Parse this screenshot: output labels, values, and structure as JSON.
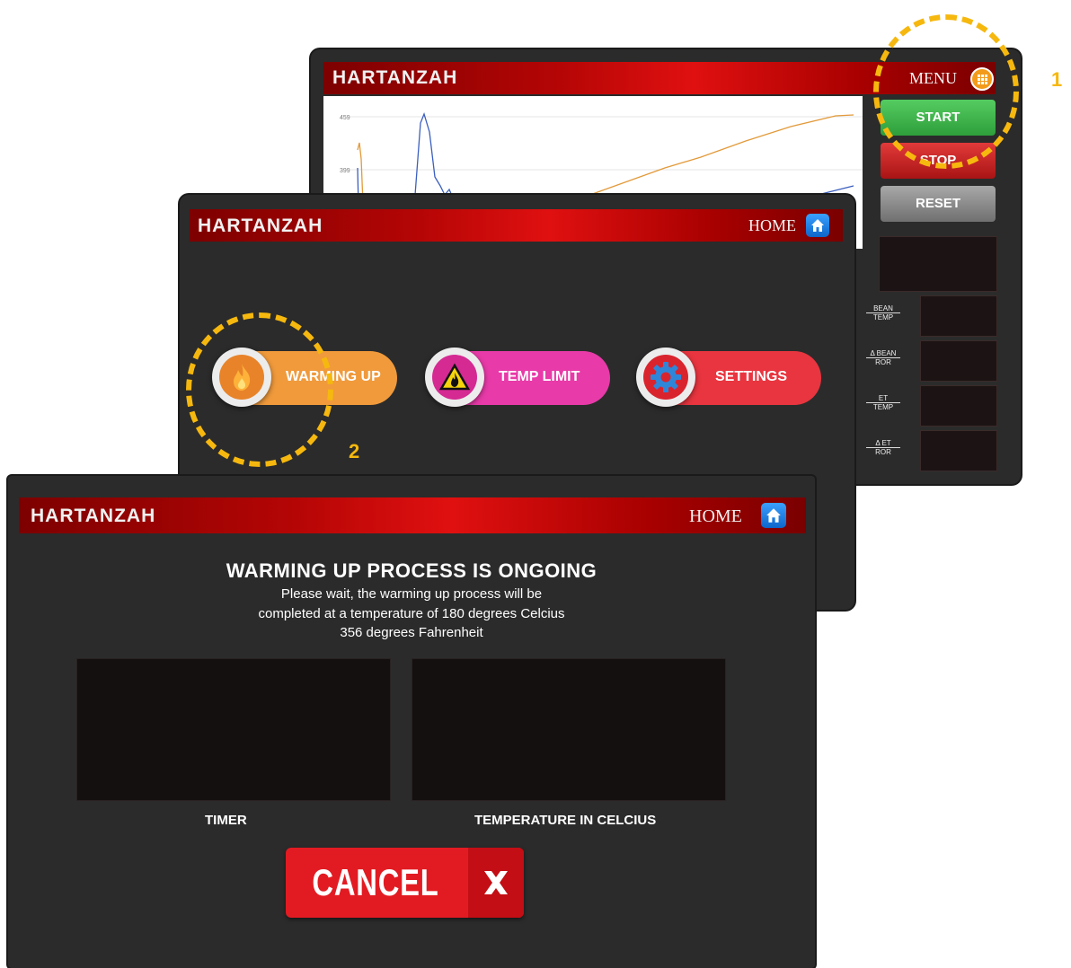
{
  "main_menu_screen": {
    "brand": "HARTANZAH",
    "menu_label": "MENU",
    "buttons": {
      "start": "START",
      "stop": "STOP",
      "reset": "RESET"
    },
    "chart_ticks": [
      "459",
      "399"
    ],
    "stat_labels": [
      {
        "top": "BEAN",
        "bottom": "TEMP"
      },
      {
        "top": "Δ BEAN",
        "bottom": "ROR"
      },
      {
        "top": "ET",
        "bottom": "TEMP"
      },
      {
        "top": "Δ ET",
        "bottom": "ROR"
      }
    ],
    "colors": {
      "start": "#3cb54a",
      "stop": "#d21f1f",
      "reset": "#8c8c8c"
    }
  },
  "menu_screen": {
    "brand": "HARTANZAH",
    "home_label": "HOME",
    "options": [
      {
        "label": "WARMING UP",
        "icon": "flame-icon",
        "color": "#f09a3c"
      },
      {
        "label": "TEMP LIMIT",
        "icon": "warning-flame-icon",
        "color": "#e83aa8"
      },
      {
        "label": "SETTINGS",
        "icon": "gear-icon",
        "color": "#e8353f"
      }
    ]
  },
  "warming_screen": {
    "brand": "HARTANZAH",
    "home_label": "HOME",
    "heading": "WARMING UP PROCESS IS ONGOING",
    "line1": "Please wait, the warming up process will be",
    "line2": "completed at a temperature of 180 degrees Celcius",
    "line3": "356 degrees Fahrenheit",
    "timer_label": "TIMER",
    "temp_label": "TEMPERATURE IN CELCIUS",
    "cancel_label": "CANCEL"
  },
  "annotations": {
    "step1": "1",
    "step2": "2",
    "color": "#f6b80e"
  }
}
